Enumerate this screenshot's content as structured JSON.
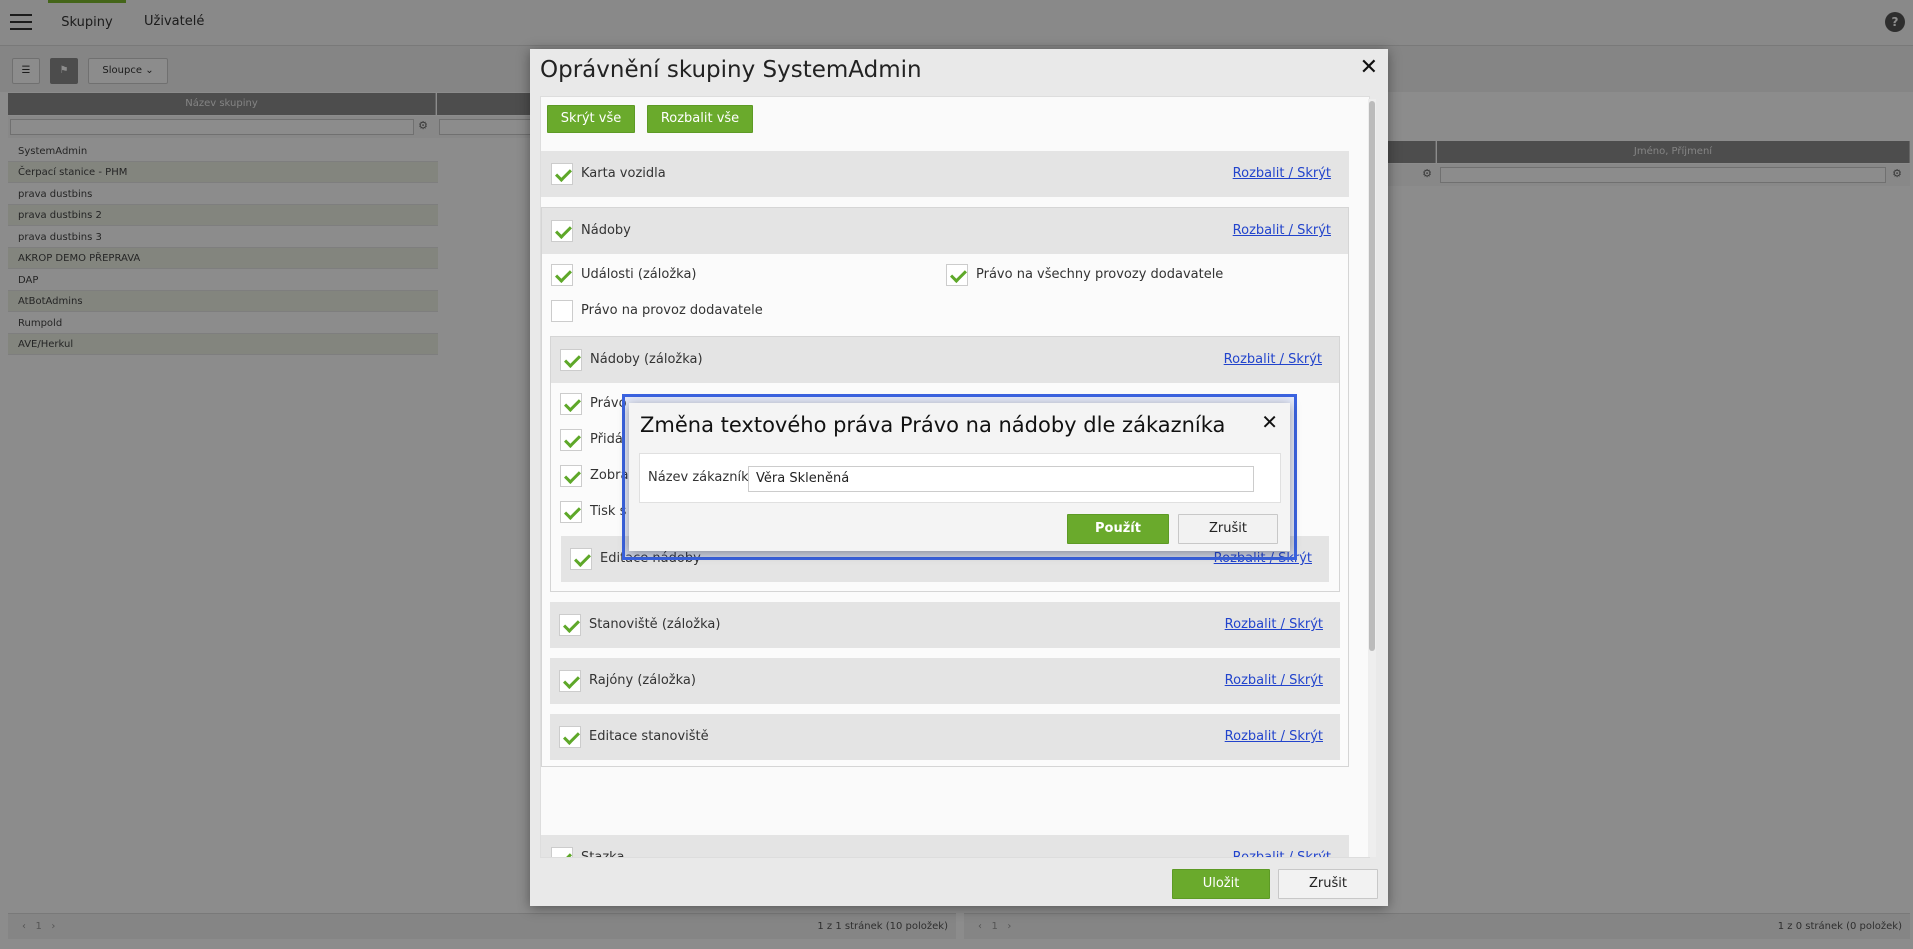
{
  "top_tabs": [
    "Skupiny",
    "Uživatelé"
  ],
  "help_symbol": "?",
  "toolbar": {
    "columns_label": "Sloupce"
  },
  "grid_left": {
    "header": "Název skupiny",
    "rows": [
      "SystemAdmin",
      "Čerpací stanice - PHM",
      "prava dustbins",
      "prava dustbins 2",
      "prava dustbins 3",
      "AKROP DEMO PŘEPRAVA",
      "DAP",
      "AtBotAdmins",
      "Rumpold",
      "AVE/Herkul"
    ],
    "pager": "1 z 1 stránek (10 položek)"
  },
  "grid_right": {
    "header": "Jméno, Příjmení",
    "pager": "1 z 0 stránek (0 položek)"
  },
  "dialog": {
    "title": "Oprávnění skupiny SystemAdmin",
    "collapse_all": "Skrýt vše",
    "expand_all": "Rozbalit vše",
    "toggle_link": "Rozbalit / Skrýt",
    "sections": {
      "karta": "Karta vozidla",
      "nadoby": "Nádoby",
      "udalosti": "Události (záložka)",
      "pravo_vsechny": "Právo na všechny provozy dodavatele",
      "pravo_provoz": "Právo na provoz dodavatele",
      "nadoby_zalozka": "Nádoby (záložka)",
      "row_a": "Právo",
      "row_b": "Přidá",
      "row_c": "Zobra",
      "row_d": "Tisk s",
      "editace_nadoby": "Editace nádoby",
      "stanoviste": "Stanoviště (záložka)",
      "rajony": "Rajóny (záložka)",
      "editace_stanoviste": "Editace stanoviště",
      "stazka": "Stazka"
    },
    "save": "Uložit",
    "cancel": "Zrušit"
  },
  "inner_dialog": {
    "title": "Změna textového práva Právo na nádoby dle zákazníka",
    "field_label": "Název zákazníka*",
    "field_value": "Věra Skleněná",
    "apply": "Použít",
    "cancel": "Zrušit"
  },
  "colors": {
    "accent_green": "#6aaa2c",
    "link_blue": "#2244cc",
    "highlight_blue": "#3b63e0"
  }
}
